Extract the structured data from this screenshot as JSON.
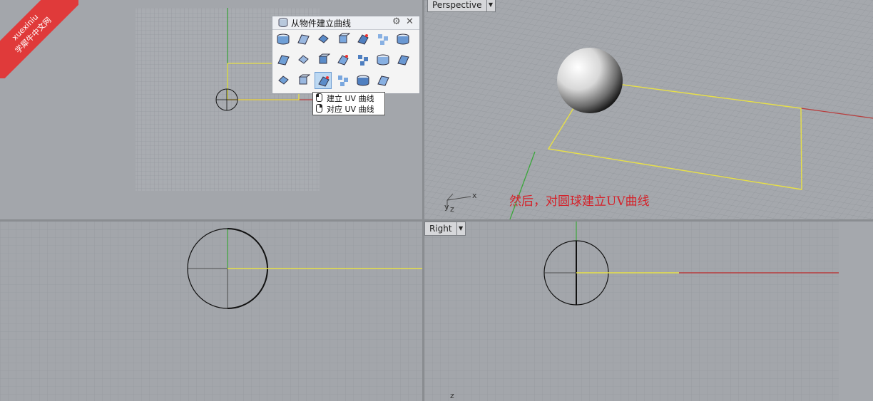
{
  "viewports": {
    "top": {
      "name": ""
    },
    "perspective": {
      "name": "Perspective"
    },
    "front": {
      "name": ""
    },
    "right": {
      "name": "Right"
    }
  },
  "toolbar": {
    "title": "从物件建立曲线",
    "buttons": [
      "extract-isocurve",
      "extract-wireframe",
      "duplicate-edge",
      "duplicate-border",
      "duplicate-face-border",
      "extract-curvature",
      "section-curves",
      "contour",
      "silhouette",
      "intersect",
      "create-2d-drawing",
      "project-curve",
      "pull-curve",
      "extract-points",
      "create-uv-curves",
      "point-cloud",
      "extrude-curve-normal",
      "apply-uv-curves",
      "make-2d",
      "blend-tool",
      ""
    ],
    "selected_index": 16
  },
  "tooltip": {
    "line1": "建立 UV 曲线",
    "line2": "对应 UV 曲线"
  },
  "annotation": "然后，对圆球建立UV曲线",
  "axis_labels": {
    "x": "x",
    "y": "y",
    "z": "z"
  },
  "watermark": {
    "line1": "xuexiniu",
    "line2": "学犀牛中文网"
  },
  "colors": {
    "curve": "#e8e046",
    "x_axis": "#b83c3c",
    "y_axis": "#3aa63a",
    "annotation": "#d4222a"
  }
}
